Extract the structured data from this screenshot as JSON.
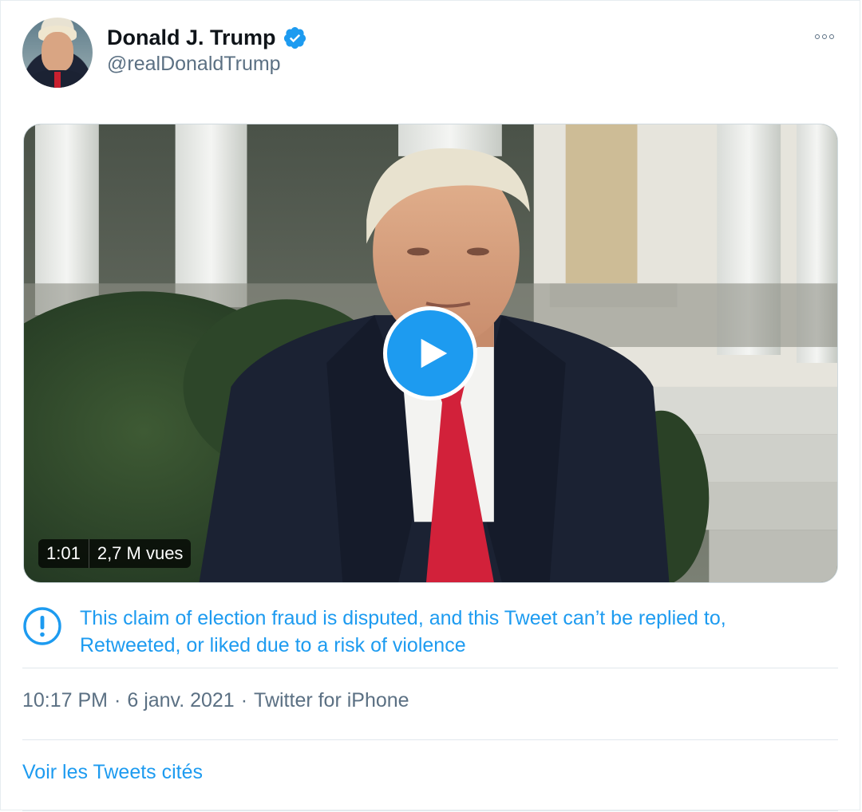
{
  "tweet": {
    "author": {
      "display_name": "Donald J. Trump",
      "handle": "@realDonaldTrump",
      "verified": true
    },
    "video": {
      "duration": "1:01",
      "views": "2,7 M vues"
    },
    "notice": "This claim of election fraud is disputed, and this Tweet can’t be replied to, Retweeted, or liked due to a risk of violence",
    "meta": {
      "time": "10:17 PM",
      "date": "6 janv. 2021",
      "source": "Twitter for iPhone",
      "separator": "·"
    },
    "quotes_link": "Voir les Tweets cités"
  },
  "icons": {
    "verified": "verified-badge-icon",
    "more": "more-icon",
    "play": "play-icon",
    "warning": "exclamation-circle-icon"
  },
  "colors": {
    "accent": "#1d9bf0",
    "text_primary": "#0f1419",
    "text_secondary": "#5b7083",
    "divider": "#e1e8ed"
  }
}
